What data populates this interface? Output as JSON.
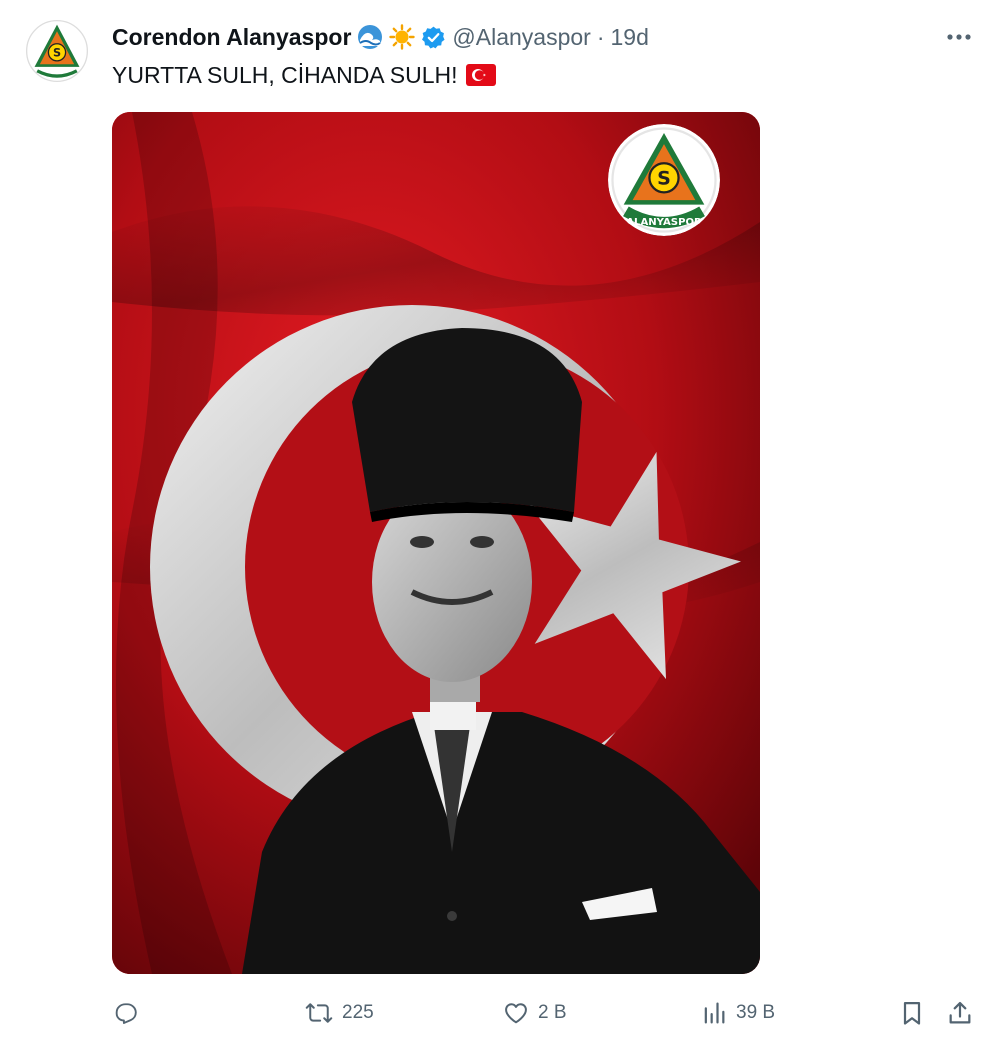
{
  "post": {
    "author": {
      "display_name": "Corendon Alanyaspor",
      "name_emoji": [
        "water-wave-emoji",
        "sun-emoji"
      ],
      "verified": true,
      "handle": "@Alanyaspor",
      "separator": "·",
      "time": "19d"
    },
    "avatar_logo": {
      "icon": "alanyaspor-crest-icon",
      "letter": "S",
      "text": "ALANYASPOR"
    },
    "text": "YURTTA SULH, CİHANDA SULH!",
    "text_emoji": "turkey-flag-emoji",
    "media": {
      "description_icon": "portrait-with-turkish-flag",
      "logo_text": "ALANYASPOR",
      "logo_letter": "S"
    },
    "actions": {
      "reply": {
        "icon": "reply-icon",
        "count": ""
      },
      "retweet": {
        "icon": "retweet-icon",
        "count": "225"
      },
      "like": {
        "icon": "heart-icon",
        "count": "2 B"
      },
      "views": {
        "icon": "views-icon",
        "count": "39 B"
      },
      "bookmark": {
        "icon": "bookmark-icon"
      },
      "share": {
        "icon": "share-icon"
      }
    },
    "more_icon": "more-icon"
  },
  "colors": {
    "text_primary": "#0f1419",
    "text_secondary": "#536471",
    "verified_blue": "#1d9bf0",
    "flag_red": "#c8101a",
    "logo_orange": "#e8731c",
    "logo_green": "#1f7a3a"
  }
}
